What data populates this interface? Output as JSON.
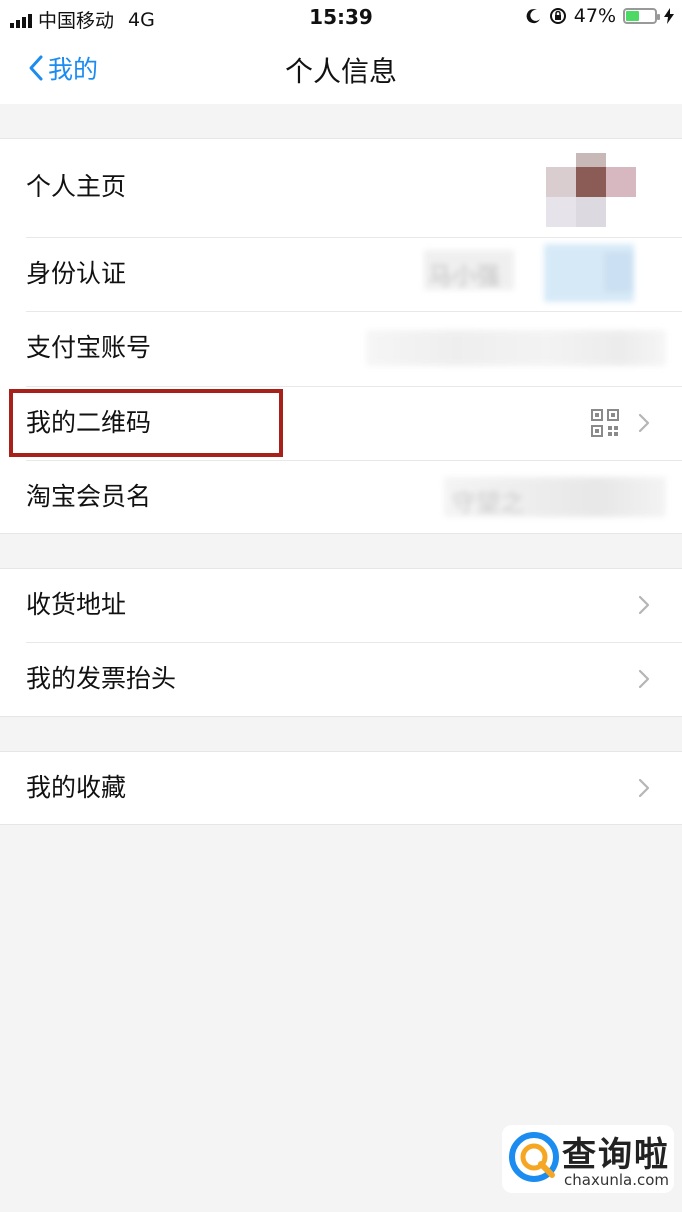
{
  "status_bar": {
    "carrier": "中国移动",
    "network": "4G",
    "time": "15:39",
    "battery_percent": "47%",
    "battery_level": 0.47,
    "icons": [
      "signal-icon",
      "moon-icon",
      "rotation-lock-icon",
      "battery-icon",
      "charging-icon"
    ]
  },
  "nav": {
    "back_label": "我的",
    "title": "个人信息"
  },
  "groups": [
    {
      "rows": [
        {
          "label": "个人主页",
          "value": "",
          "accessory": "avatar"
        },
        {
          "label": "身份认证",
          "value": "马小强",
          "accessory": "blurred"
        },
        {
          "label": "支付宝账号",
          "value": "",
          "accessory": "blurred"
        },
        {
          "label": "我的二维码",
          "value": "",
          "accessory": "qrcode-icon"
        },
        {
          "label": "淘宝会员名",
          "value": "守望之",
          "accessory": "blurred"
        }
      ]
    },
    {
      "rows": [
        {
          "label": "收货地址",
          "accessory": "chevron-right-icon"
        },
        {
          "label": "我的发票抬头",
          "accessory": "chevron-right-icon"
        }
      ]
    },
    {
      "rows": [
        {
          "label": "我的收藏",
          "accessory": "chevron-right-icon"
        }
      ]
    }
  ],
  "watermark": {
    "name": "查询啦",
    "url": "chaxunla.com"
  },
  "colors": {
    "accent": "#1c8cf0",
    "highlight_border": "#a8201a",
    "background": "#f4f4f4",
    "battery": "#4cd964"
  }
}
